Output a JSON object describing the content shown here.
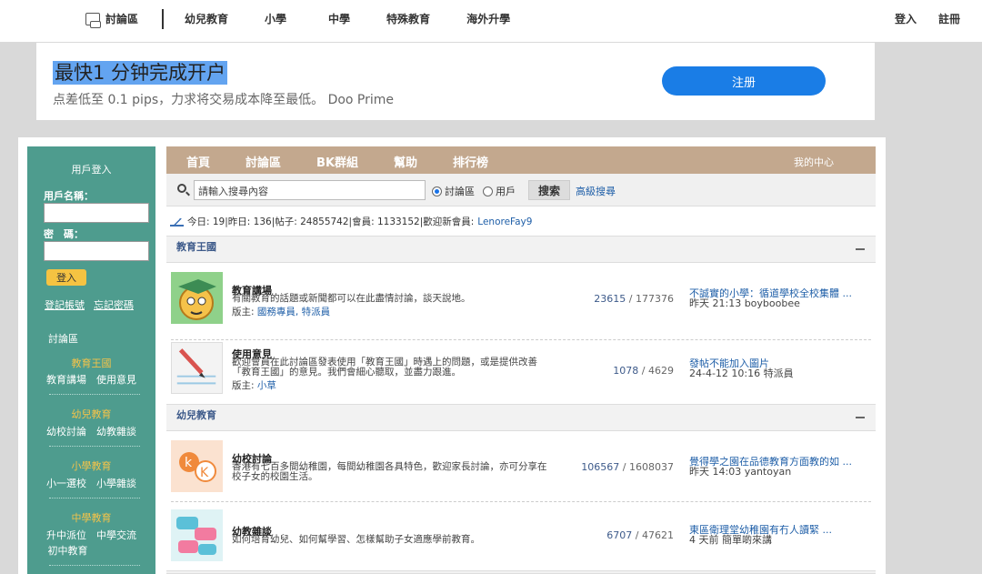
{
  "topnav": {
    "forum": "討論區",
    "links": [
      "幼兒教育",
      "小學",
      "中學",
      "特殊教育",
      "海外升學"
    ],
    "login": "登入",
    "register": "註冊"
  },
  "ad": {
    "headline": "最快1 分钟完成开户",
    "sub": "点差低至 0.1 pips，力求将交易成本降至最低。 Doo Prime",
    "button": "注册"
  },
  "sidebar": {
    "login_title": "用戶登入",
    "username_label": "用戶名稱：",
    "password_label": "密　碼：",
    "login_button": "登入",
    "register_link": "登記帳號",
    "forgot_link": "忘記密碼",
    "forum_label": "討論區",
    "categories": [
      {
        "name": "教育王國",
        "subs": "教育講場　使用意見"
      },
      {
        "name": "幼兒教育",
        "subs": "幼校討論　幼教雜談"
      },
      {
        "name": "小學教育",
        "subs": "小一選校　小學雜談"
      },
      {
        "name": "中學教育",
        "subs": "升中派位　中學交流",
        "subs2": "初中教育"
      }
    ]
  },
  "bar": {
    "items": [
      "首頁",
      "討論區",
      "BK群組",
      "幫助",
      "排行榜"
    ],
    "mine": "我的中心"
  },
  "search": {
    "placeholder": "請輸入搜尋內容",
    "opt_forum": "討論區",
    "opt_user": "用戶",
    "button": "搜索",
    "advanced": "高級搜尋"
  },
  "stats": {
    "text": "今日: 19|昨日: 136|帖子: 24855742|會員: 1133152|歡迎新會員:",
    "new_member": "LenoreFay9"
  },
  "sections": [
    {
      "title": "教育王國",
      "forums": [
        {
          "name": "教育講場",
          "desc": "有關教育的話題或新聞都可以在此盡情討論，談天說地。",
          "mod_label": "版主:",
          "mods": "國務專員, 特派員",
          "threads": "23615",
          "posts": "177376",
          "last_title": "不誠實的小學：循道學校全校集體 ...",
          "last_meta": "昨天 21:13 boyboobee"
        },
        {
          "name": "使用意見",
          "desc": "歡迎會員在此討論區發表使用「教育王國」時遇上的問題，或是提供改善「教育王國」的意見。我們會細心聽取，並盡力跟進。",
          "mod_label": "版主:",
          "mods": "小草",
          "threads": "1078",
          "posts": "4629",
          "last_title": "發帖不能加入圖片",
          "last_meta": "24-4-12 10:16 特派員"
        }
      ]
    },
    {
      "title": "幼兒教育",
      "forums": [
        {
          "name": "幼校討論",
          "desc": "香港有七百多間幼稚園，每間幼稚園各具特色，歡迎家長討論，亦可分享在校子女的校園生活。",
          "threads": "106567",
          "posts": "1608037",
          "last_title": "覺得學之園在品德教育方面教的如 ...",
          "last_meta": "昨天 14:03 yantoyan"
        },
        {
          "name": "幼教雜談",
          "desc": "如何培育幼兒、如何幫學習、怎樣幫助子女適應學前教育。",
          "threads": "6707",
          "posts": "47621",
          "last_title": "東區衛理堂幼稚園有冇人讀緊 ...",
          "last_meta": "4 天前 簡單啲來講"
        }
      ]
    }
  ],
  "colors": {
    "sidebar": "#4e9c8e",
    "bar": "#c3a88e",
    "accent_blue": "#1a7de6",
    "link": "#1f5fa8"
  }
}
